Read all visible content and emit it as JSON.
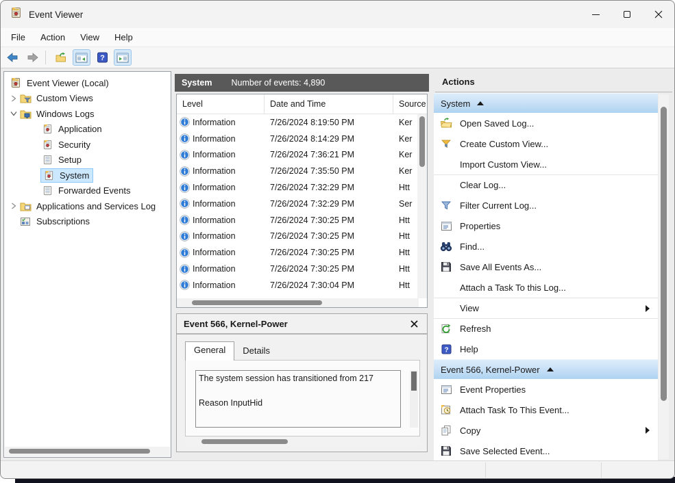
{
  "titlebar": {
    "title": "Event Viewer"
  },
  "menubar": {
    "items": [
      "File",
      "Action",
      "View",
      "Help"
    ]
  },
  "toolbar": {
    "buttons": [
      "back",
      "forward",
      "export",
      "show-console-tree",
      "help",
      "show-action-pane"
    ]
  },
  "tree": {
    "items": [
      {
        "label": "Event Viewer (Local)"
      },
      {
        "label": "Custom Views"
      },
      {
        "label": "Windows Logs"
      },
      {
        "label": "Application"
      },
      {
        "label": "Security"
      },
      {
        "label": "Setup"
      },
      {
        "label": "System",
        "selected": true
      },
      {
        "label": "Forwarded Events"
      },
      {
        "label": "Applications and Services Log"
      },
      {
        "label": "Subscriptions"
      }
    ]
  },
  "events": {
    "log_name": "System",
    "count_label": "Number of events: 4,890",
    "columns": [
      "Level",
      "Date and Time",
      "Source"
    ],
    "rows": [
      {
        "level": "Information",
        "datetime": "7/26/2024 8:19:50 PM",
        "source": "Ker"
      },
      {
        "level": "Information",
        "datetime": "7/26/2024 8:14:29 PM",
        "source": "Ker"
      },
      {
        "level": "Information",
        "datetime": "7/26/2024 7:36:21 PM",
        "source": "Ker"
      },
      {
        "level": "Information",
        "datetime": "7/26/2024 7:35:50 PM",
        "source": "Ker"
      },
      {
        "level": "Information",
        "datetime": "7/26/2024 7:32:29 PM",
        "source": "Htt"
      },
      {
        "level": "Information",
        "datetime": "7/26/2024 7:32:29 PM",
        "source": "Ser"
      },
      {
        "level": "Information",
        "datetime": "7/26/2024 7:30:25 PM",
        "source": "Htt"
      },
      {
        "level": "Information",
        "datetime": "7/26/2024 7:30:25 PM",
        "source": "Htt"
      },
      {
        "level": "Information",
        "datetime": "7/26/2024 7:30:25 PM",
        "source": "Htt"
      },
      {
        "level": "Information",
        "datetime": "7/26/2024 7:30:25 PM",
        "source": "Htt"
      },
      {
        "level": "Information",
        "datetime": "7/26/2024 7:30:04 PM",
        "source": "Htt"
      }
    ]
  },
  "detail": {
    "title": "Event 566, Kernel-Power",
    "tabs": [
      "General",
      "Details"
    ],
    "message_line1": "The system session has transitioned from 217",
    "message_line2": "Reason InputHid"
  },
  "actions": {
    "title": "Actions",
    "sections": [
      {
        "header": "System",
        "items": [
          {
            "label": "Open Saved Log..."
          },
          {
            "label": "Create Custom View..."
          },
          {
            "label": "Import Custom View..."
          },
          {
            "label": "Clear Log..."
          },
          {
            "label": "Filter Current Log..."
          },
          {
            "label": "Properties"
          },
          {
            "label": "Find..."
          },
          {
            "label": "Save All Events As..."
          },
          {
            "label": "Attach a Task To this Log..."
          },
          {
            "label": "View"
          },
          {
            "label": "Refresh"
          },
          {
            "label": "Help"
          }
        ]
      },
      {
        "header": "Event 566, Kernel-Power",
        "items": [
          {
            "label": "Event Properties"
          },
          {
            "label": "Attach Task To This Event..."
          },
          {
            "label": "Copy"
          },
          {
            "label": "Save Selected Event..."
          }
        ]
      }
    ]
  }
}
